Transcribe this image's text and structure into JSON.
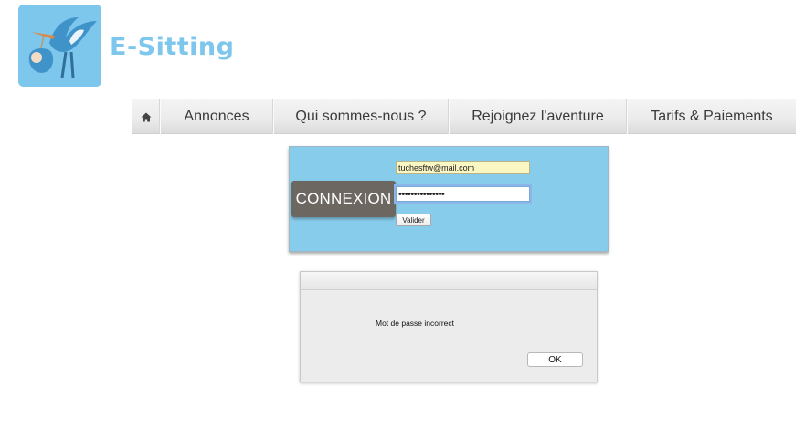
{
  "brand": {
    "name": "E-Sitting",
    "logo_icon": "stork-carrying-baby-icon",
    "color": "#7dc6ec"
  },
  "nav": {
    "home_icon": "home-icon",
    "items": [
      {
        "label": "Annonces"
      },
      {
        "label": "Qui sommes-nous ?"
      },
      {
        "label": "Rejoignez l'aventure"
      },
      {
        "label": "Tarifs & Paiements"
      }
    ]
  },
  "login": {
    "title": "CONNEXION",
    "email_value": "tuchesftw@mail.com",
    "password_value": "•••••••••••••••",
    "submit_label": "Valider",
    "panel_color": "#88ccec"
  },
  "alert": {
    "message": "Mot de passe incorrect",
    "ok_label": "OK"
  }
}
